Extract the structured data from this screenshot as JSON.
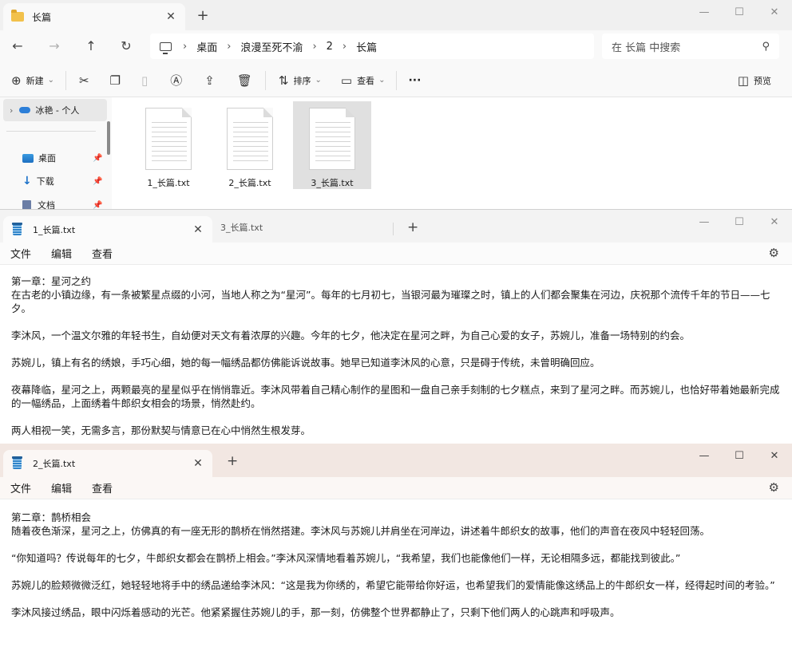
{
  "explorer": {
    "tab_title": "长篇",
    "tab_close": "✕",
    "tab_add": "+",
    "window_controls": {
      "minimize": "—",
      "maximize": "☐",
      "close": "✕"
    },
    "nav": {
      "back": "←",
      "forward": "→",
      "up": "↑",
      "refresh": "↻"
    },
    "breadcrumb": {
      "sep": "›",
      "items": [
        "桌面",
        "浪漫至死不渝",
        "2",
        "长篇"
      ]
    },
    "search_placeholder": "在 长篇 中搜索",
    "toolbar": {
      "new_label": "新建",
      "sort_label": "排序",
      "view_label": "查看",
      "more_label": "···",
      "preview_label": "预览",
      "dropdown_caret": "⌄"
    },
    "sidebar": {
      "onedrive_label": "冰艳 - 个人",
      "items": [
        {
          "label": "桌面"
        },
        {
          "label": "下载"
        },
        {
          "label": "文档"
        }
      ]
    },
    "files": [
      {
        "name": "1_长篇.txt",
        "selected": false
      },
      {
        "name": "2_长篇.txt",
        "selected": false
      },
      {
        "name": "3_长篇.txt",
        "selected": true
      }
    ]
  },
  "notepad1": {
    "active_tab": "1_长篇.txt",
    "inactive_tab": "3_长篇.txt",
    "menu": [
      "文件",
      "编辑",
      "查看"
    ],
    "lines": [
      "第一章：星河之约",
      "在古老的小镇边缘，有一条被繁星点缀的小河，当地人称之为“星河”。每年的七月初七，当银河最为璀璨之时，镇上的人们都会聚集在河边，庆祝那个流传千年的节日——七夕。",
      "李沐风，一个温文尔雅的年轻书生，自幼便对天文有着浓厚的兴趣。今年的七夕，他决定在星河之畔，为自己心爱的女子，苏婉儿，准备一场特别的约会。",
      "苏婉儿，镇上有名的绣娘，手巧心细，她的每一幅绣品都仿佛能诉说故事。她早已知道李沐风的心意，只是碍于传统，未曾明确回应。",
      "夜幕降临，星河之上，两颗最亮的星星似乎在悄悄靠近。李沐风带着自己精心制作的星图和一盘自己亲手刻制的七夕糕点，来到了星河之畔。而苏婉儿，也恰好带着她最新完成的一幅绣品，上面绣着牛郎织女相会的场景，悄然赴约。",
      "两人相视一笑，无需多言，那份默契与情意已在心中悄然生根发芽。"
    ]
  },
  "notepad2": {
    "active_tab": "2_长篇.txt",
    "menu": [
      "文件",
      "编辑",
      "查看"
    ],
    "lines": [
      "第二章：鹊桥相会",
      "随着夜色渐深，星河之上，仿佛真的有一座无形的鹊桥在悄然搭建。李沐风与苏婉儿并肩坐在河岸边，讲述着牛郎织女的故事，他们的声音在夜风中轻轻回荡。",
      "“你知道吗？传说每年的七夕，牛郎织女都会在鹊桥上相会。”李沐风深情地看着苏婉儿，“我希望，我们也能像他们一样，无论相隔多远，都能找到彼此。”",
      "苏婉儿的脸颊微微泛红，她轻轻地将手中的绣品递给李沐风：“这是我为你绣的，希望它能带给你好运，也希望我们的爱情能像这绣品上的牛郎织女一样，经得起时间的考验。”",
      "李沐风接过绣品，眼中闪烁着感动的光芒。他紧紧握住苏婉儿的手，那一刻，仿佛整个世界都静止了，只剩下他们两人的心跳声和呼吸声。"
    ]
  }
}
